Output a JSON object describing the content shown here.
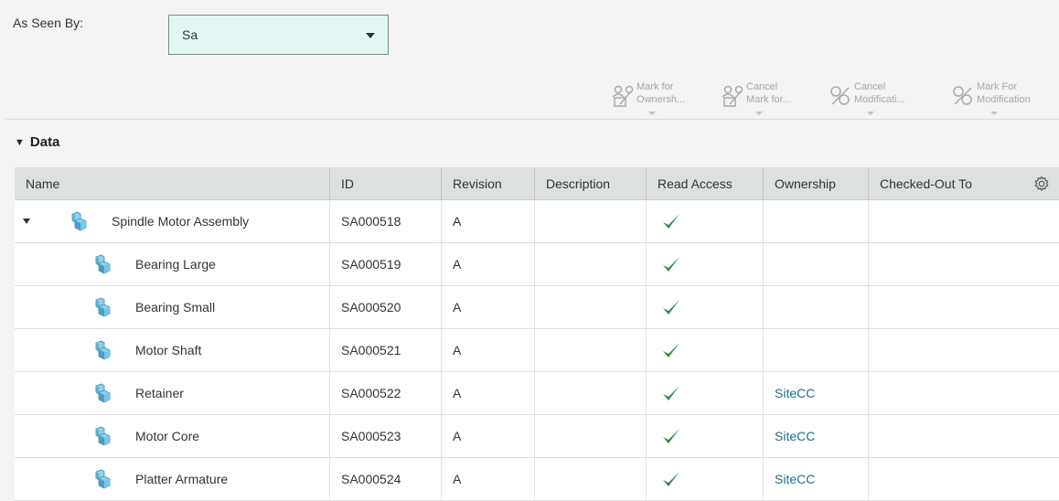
{
  "header": {
    "as_seen_by_label": "As Seen By:",
    "as_seen_by_value": "Sa"
  },
  "toolbar": [
    {
      "line1": "Mark for",
      "line2": "Ownersh...",
      "icon": "mark-ownership-icon"
    },
    {
      "line1": "Cancel",
      "line2": "Mark for...",
      "icon": "cancel-mark-icon"
    },
    {
      "line1": "Cancel",
      "line2": "Modificati...",
      "icon": "cancel-modification-icon"
    },
    {
      "line1": "Mark For",
      "line2": "Modification",
      "icon": "mark-modification-icon"
    }
  ],
  "section": {
    "title": "Data"
  },
  "table": {
    "columns": [
      "Name",
      "ID",
      "Revision",
      "Description",
      "Read Access",
      "Ownership",
      "Checked-Out To"
    ],
    "rows": [
      {
        "name": "Spindle Motor Assembly",
        "id": "SA000518",
        "revision": "A",
        "description": "",
        "read_access": true,
        "ownership": "",
        "checked_out_to": "",
        "level": 0,
        "expandable": true
      },
      {
        "name": "Bearing Large",
        "id": "SA000519",
        "revision": "A",
        "description": "",
        "read_access": true,
        "ownership": "",
        "checked_out_to": "",
        "level": 1,
        "expandable": false
      },
      {
        "name": "Bearing Small",
        "id": "SA000520",
        "revision": "A",
        "description": "",
        "read_access": true,
        "ownership": "",
        "checked_out_to": "",
        "level": 1,
        "expandable": false
      },
      {
        "name": "Motor Shaft",
        "id": "SA000521",
        "revision": "A",
        "description": "",
        "read_access": true,
        "ownership": "",
        "checked_out_to": "",
        "level": 1,
        "expandable": false
      },
      {
        "name": "Retainer",
        "id": "SA000522",
        "revision": "A",
        "description": "",
        "read_access": true,
        "ownership": "SiteCC",
        "checked_out_to": "",
        "level": 1,
        "expandable": false
      },
      {
        "name": "Motor Core",
        "id": "SA000523",
        "revision": "A",
        "description": "",
        "read_access": true,
        "ownership": "SiteCC",
        "checked_out_to": "",
        "level": 1,
        "expandable": false
      },
      {
        "name": "Platter Armature",
        "id": "SA000524",
        "revision": "A",
        "description": "",
        "read_access": true,
        "ownership": "SiteCC",
        "checked_out_to": "",
        "level": 1,
        "expandable": false
      }
    ]
  },
  "colors": {
    "select_bg": "#e2f7f3",
    "check": "#2f8a4e",
    "link": "#1f6f8b",
    "header_bg": "#dde0e1"
  }
}
